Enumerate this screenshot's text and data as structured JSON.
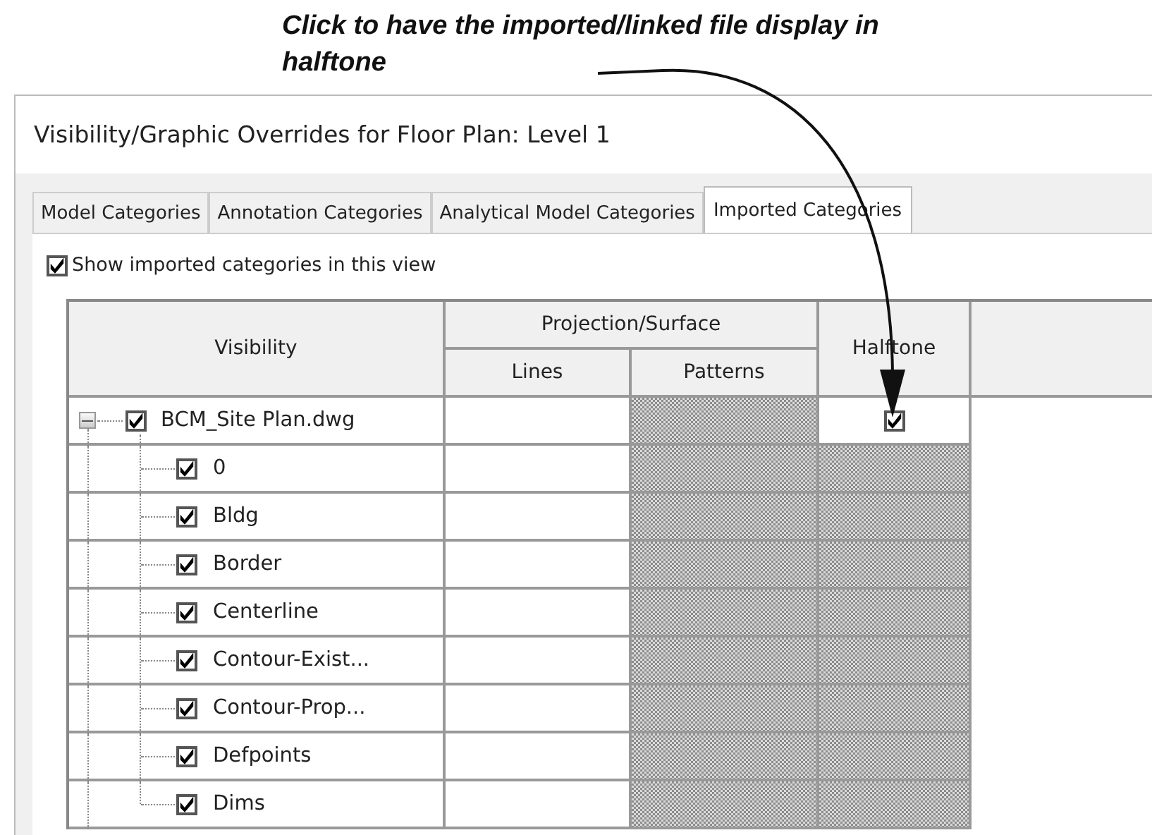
{
  "callout": {
    "text": "Click to have the imported/linked file display in halftone"
  },
  "window": {
    "title": "Visibility/Graphic Overrides for Floor Plan: Level 1"
  },
  "tabs": [
    {
      "label": "Model Categories",
      "selected": false
    },
    {
      "label": "Annotation Categories",
      "selected": false
    },
    {
      "label": "Analytical Model Categories",
      "selected": false
    },
    {
      "label": "Imported Categories",
      "selected": true
    }
  ],
  "show_imported": {
    "label": "Show imported categories in this view",
    "checked": true
  },
  "table": {
    "columns": {
      "visibility": "Visibility",
      "group": "Projection/Surface",
      "lines": "Lines",
      "patterns": "Patterns",
      "halftone": "Halftone"
    },
    "rows": [
      {
        "name": "BCM_Site Plan.dwg",
        "checked": true,
        "expanded": true,
        "halftone": true,
        "children": [
          {
            "name": "0",
            "checked": true
          },
          {
            "name": "Bldg",
            "checked": true
          },
          {
            "name": "Border",
            "checked": true
          },
          {
            "name": "Centerline",
            "checked": true
          },
          {
            "name": "Contour-Exist...",
            "checked": true
          },
          {
            "name": "Contour-Prop...",
            "checked": true
          },
          {
            "name": "Defpoints",
            "checked": true
          },
          {
            "name": "Dims",
            "checked": true
          }
        ]
      }
    ]
  }
}
